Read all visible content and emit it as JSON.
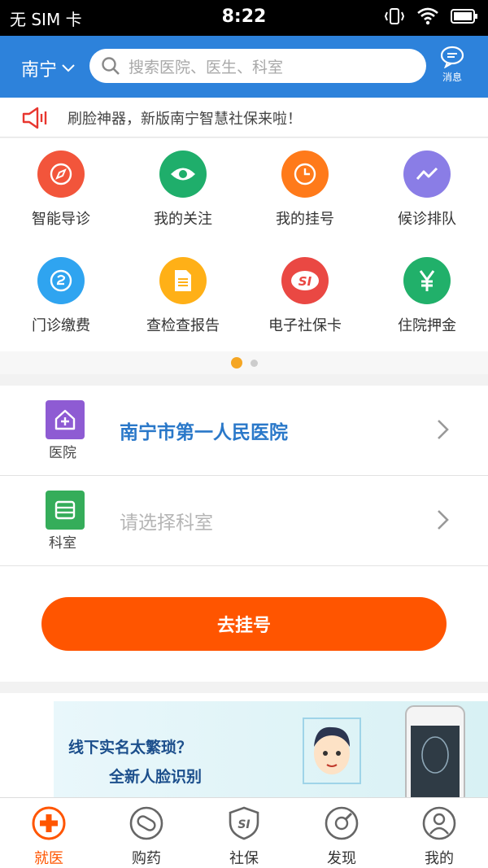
{
  "status_bar": {
    "carrier": "无 SIM 卡",
    "time": "8:22"
  },
  "header": {
    "city": "南宁",
    "search_placeholder": "搜索医院、医生、科室",
    "message_label": "消息"
  },
  "notice": {
    "text": "刷脸神器，新版南宁智慧社保来啦！"
  },
  "grid": {
    "items": [
      {
        "label": "智能导诊",
        "color": "#f2553b",
        "icon": "compass-icon"
      },
      {
        "label": "我的关注",
        "color": "#1fae6b",
        "icon": "eye-icon"
      },
      {
        "label": "我的挂号",
        "color": "#ff7a1a",
        "icon": "clock-icon"
      },
      {
        "label": "候诊排队",
        "color": "#8a7de6",
        "icon": "trend-icon"
      },
      {
        "label": "门诊缴费",
        "color": "#2fa4f0",
        "icon": "coin-icon"
      },
      {
        "label": "查检查报告",
        "color": "#ffb017",
        "icon": "report-icon"
      },
      {
        "label": "电子社保卡",
        "color": "#ea4843",
        "icon": "si-card-icon"
      },
      {
        "label": "住院押金",
        "color": "#21b06a",
        "icon": "yuan-icon"
      }
    ]
  },
  "selector": {
    "hospital_label": "医院",
    "hospital_value": "南宁市第一人民医院",
    "department_label": "科室",
    "department_value": "请选择科室"
  },
  "register_button": "去挂号",
  "banner": {
    "line1": "线下实名太繁琐？",
    "line2": "全新人脸识别"
  },
  "tabbar": {
    "tabs": [
      {
        "label": "就医",
        "active": true
      },
      {
        "label": "购药",
        "active": false
      },
      {
        "label": "社保",
        "active": false
      },
      {
        "label": "发现",
        "active": false
      },
      {
        "label": "我的",
        "active": false
      }
    ]
  },
  "colors": {
    "header_blue": "#2d82db",
    "accent_orange": "#ff5500",
    "hospital_text": "#2a78c9"
  }
}
